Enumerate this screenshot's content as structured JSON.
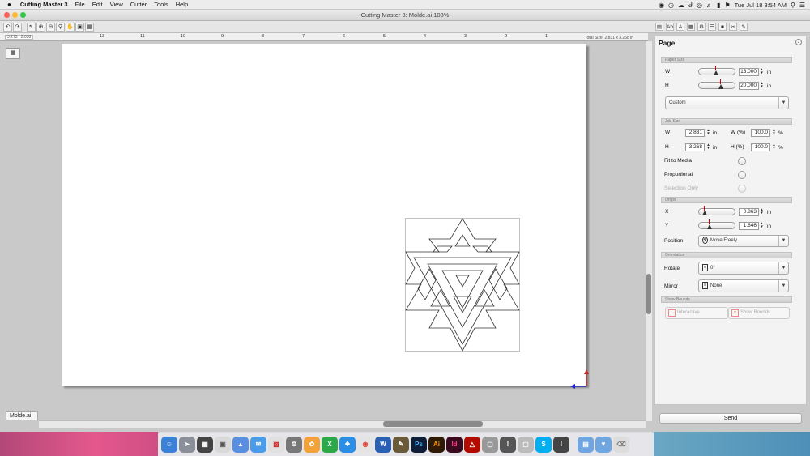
{
  "menubar": {
    "apple": "",
    "app_name": "Cutting Master 3",
    "items": [
      "File",
      "Edit",
      "View",
      "Cutter",
      "Tools",
      "Help"
    ],
    "clock": "Tue Jul 18  8:54 AM"
  },
  "window": {
    "title": "Cutting Master 3: Molde.ai 108%",
    "file_tab": "Molde.ai"
  },
  "ruler": {
    "coord": "3.273 , 2.038",
    "total_size": "Total Size: 2.831 x 3.268 in",
    "labels": [
      "13",
      "11",
      "10",
      "9",
      "8",
      "7",
      "6",
      "5",
      "4",
      "3",
      "2",
      "1"
    ]
  },
  "panel": {
    "title": "Page",
    "paper_size": {
      "section": "Paper Size",
      "w_label": "W",
      "w_value": "13.000",
      "w_unit": "in",
      "w_level": 0.4,
      "h_label": "H",
      "h_value": "20.000",
      "h_unit": "in",
      "h_level": 0.55,
      "preset": "Custom"
    },
    "job_size": {
      "section": "Job Size",
      "w_label": "W",
      "w_value": "2.831",
      "w_unit": "in",
      "h_label": "H",
      "h_value": "3.268",
      "h_unit": "in",
      "wp_label": "W (%)",
      "wp_value": "100.0",
      "wp_unit": "%",
      "hp_label": "H (%)",
      "hp_value": "100.0",
      "hp_unit": "%",
      "fit_label": "Fit to Media",
      "prop_label": "Proportional",
      "sel_label": "Selection Only"
    },
    "origin": {
      "section": "Origin",
      "x_label": "X",
      "x_value": "0.863",
      "x_unit": "in",
      "x_level": 0.05,
      "y_label": "Y",
      "y_value": "1.646",
      "y_unit": "in",
      "y_level": 0.2,
      "pos_label": "Position",
      "pos_value": "Move Freely"
    },
    "orientation": {
      "section": "Orientation",
      "rotate_label": "Rotate",
      "rotate_value": "0°",
      "mirror_label": "Mirror",
      "mirror_value": "None"
    },
    "show_bounds": {
      "section": "Show Bounds",
      "interactive": "Interactive",
      "show": "Show Bounds"
    },
    "send": "Send"
  },
  "colors": {
    "close": "#fc5f57",
    "minimize": "#fdbc2e",
    "zoom": "#33c748",
    "origin_x": "#2222cc",
    "origin_y": "#cc2222"
  }
}
